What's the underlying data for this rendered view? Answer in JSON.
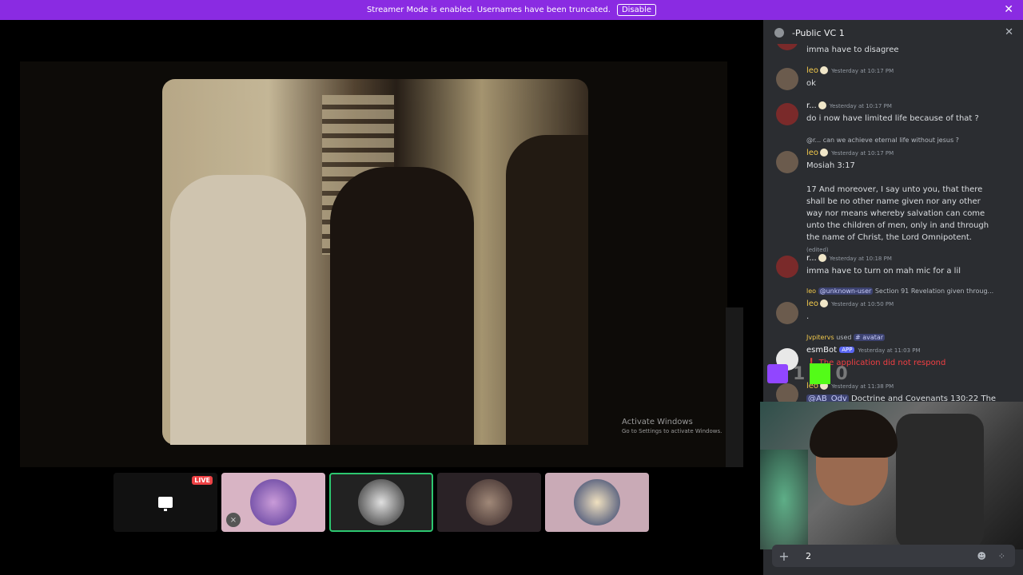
{
  "banner": {
    "text": "Streamer Mode is enabled. Usernames have been truncated.",
    "button": "Disable",
    "close": "✕"
  },
  "stage": {
    "activate": {
      "line1": "Activate Windows",
      "line2": "Go to Settings to activate Windows."
    },
    "tiles": [
      {
        "type": "screen",
        "live": "LIVE"
      },
      {
        "type": "user"
      },
      {
        "type": "user"
      },
      {
        "type": "user"
      },
      {
        "type": "user"
      }
    ]
  },
  "chat": {
    "title": "-Public VC 1",
    "messages": [
      {
        "text": "imma have to disagree"
      },
      {
        "name": "leo",
        "time": "Yesterday at 10:17 PM",
        "text": "ok"
      },
      {
        "name": "r...",
        "time": "Yesterday at 10:17 PM",
        "text": "do i now have limited life because of that ?"
      },
      {
        "reply_name": "@r...",
        "reply_text": "can we achieve eternal life without jesus ?",
        "name": "leo",
        "time": "Yesterday at 10:17 PM",
        "text": "Mosiah 3:17",
        "text2": "17 And moreover, I say unto you, that there shall be no other name given nor any other way nor means whereby salvation can come unto the children of men, only in and through the name of Christ, the Lord Omnipotent.",
        "edited": "(edited)"
      },
      {
        "name": "r...",
        "time": "Yesterday at 10:18 PM",
        "text": "imma have to turn on mah mic for a lil"
      },
      {
        "reply_name": "leo",
        "reply_mention": "@unknown-user",
        "reply_text": "Section 91 Revelation given throug...",
        "name": "leo",
        "time": "Yesterday at 10:50 PM",
        "text": "."
      },
      {
        "reply_name": "Jvpitervs",
        "reply_used": "used",
        "reply_command": "# avatar",
        "name": "esmBot",
        "app": "APP",
        "time": "Yesterday at 11:03 PM",
        "text": "The application did not respond"
      },
      {
        "name": "leo",
        "time": "Yesterday at 11:38 PM",
        "mention": "@AB_Odv",
        "text": "Doctrine and Covenants 130:22 The"
      }
    ],
    "input_value": "2"
  },
  "overlay": {
    "twitch_count": "1",
    "kick_count": "0"
  },
  "colors": {
    "banner": "#8a2be2",
    "live": "#ed4245",
    "speaking": "#2dc770",
    "username": "#f2c94c"
  }
}
